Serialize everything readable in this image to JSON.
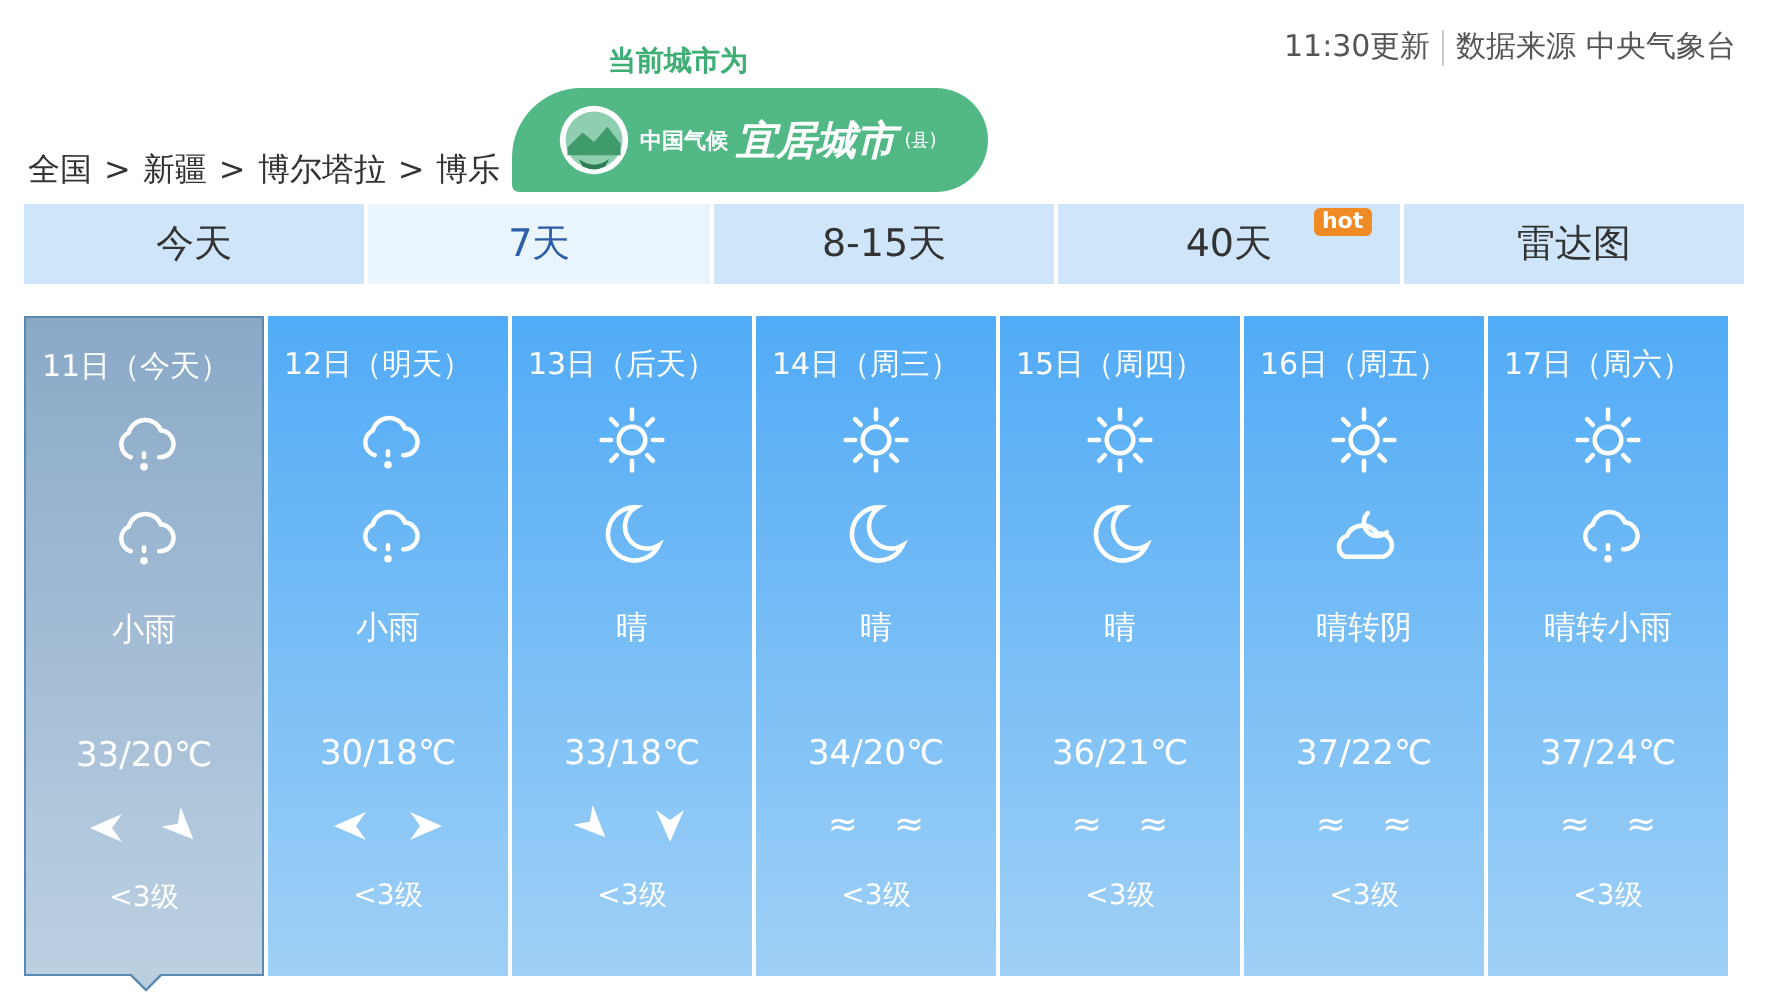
{
  "header": {
    "updated": "11:30更新",
    "source": "数据来源 中央气象台"
  },
  "badge": {
    "caption": "当前城市为",
    "small": "中国气候",
    "title": "宜居城市",
    "suffix": "(县)"
  },
  "breadcrumb": [
    "全国",
    "新疆",
    "博尔塔拉",
    "博乐"
  ],
  "breadcrumb_separator": ">",
  "tabs": [
    {
      "label": "今天",
      "selected": false
    },
    {
      "label": "7天",
      "selected": true
    },
    {
      "label": "8-15天",
      "selected": false
    },
    {
      "label": "40天",
      "selected": false,
      "badge": "hot"
    },
    {
      "label": "雷达图",
      "selected": false
    }
  ],
  "days": [
    {
      "date": "11日（今天）",
      "selected": true,
      "icons": [
        {
          "kind": "rain"
        },
        {
          "kind": "rain"
        }
      ],
      "weather": "小雨",
      "temp": "33/20℃",
      "wind": [
        {
          "kind": "arrow_w"
        },
        {
          "kind": "arrow_se"
        }
      ],
      "level": "<3级"
    },
    {
      "date": "12日（明天）",
      "selected": false,
      "icons": [
        {
          "kind": "rain"
        },
        {
          "kind": "rain"
        }
      ],
      "weather": "小雨",
      "temp": "30/18℃",
      "wind": [
        {
          "kind": "arrow_w"
        },
        {
          "kind": "arrow_e"
        }
      ],
      "level": "<3级"
    },
    {
      "date": "13日（后天）",
      "selected": false,
      "icons": [
        {
          "kind": "sun"
        },
        {
          "kind": "moon"
        }
      ],
      "weather": "晴",
      "temp": "33/18℃",
      "wind": [
        {
          "kind": "arrow_se"
        },
        {
          "kind": "arrow_s"
        }
      ],
      "level": "<3级"
    },
    {
      "date": "14日（周三）",
      "selected": false,
      "icons": [
        {
          "kind": "sun"
        },
        {
          "kind": "moon"
        }
      ],
      "weather": "晴",
      "temp": "34/20℃",
      "wind": [
        {
          "kind": "text",
          "text": "≈"
        },
        {
          "kind": "text",
          "text": "≈"
        }
      ],
      "level": "<3级"
    },
    {
      "date": "15日（周四）",
      "selected": false,
      "icons": [
        {
          "kind": "sun"
        },
        {
          "kind": "moon"
        }
      ],
      "weather": "晴",
      "temp": "36/21℃",
      "wind": [
        {
          "kind": "text",
          "text": "≈"
        },
        {
          "kind": "text",
          "text": "≈"
        }
      ],
      "level": "<3级"
    },
    {
      "date": "16日（周五）",
      "selected": false,
      "icons": [
        {
          "kind": "sun"
        },
        {
          "kind": "cloud_moon"
        }
      ],
      "weather": "晴转阴",
      "temp": "37/22℃",
      "wind": [
        {
          "kind": "text",
          "text": "≈"
        },
        {
          "kind": "text",
          "text": "≈"
        }
      ],
      "level": "<3级"
    },
    {
      "date": "17日（周六）",
      "selected": false,
      "icons": [
        {
          "kind": "sun"
        },
        {
          "kind": "rain"
        }
      ],
      "weather": "晴转小雨",
      "temp": "37/24℃",
      "wind": [
        {
          "kind": "text",
          "text": "≈"
        },
        {
          "kind": "text",
          "text": "≈"
        }
      ],
      "level": "<3级"
    }
  ]
}
